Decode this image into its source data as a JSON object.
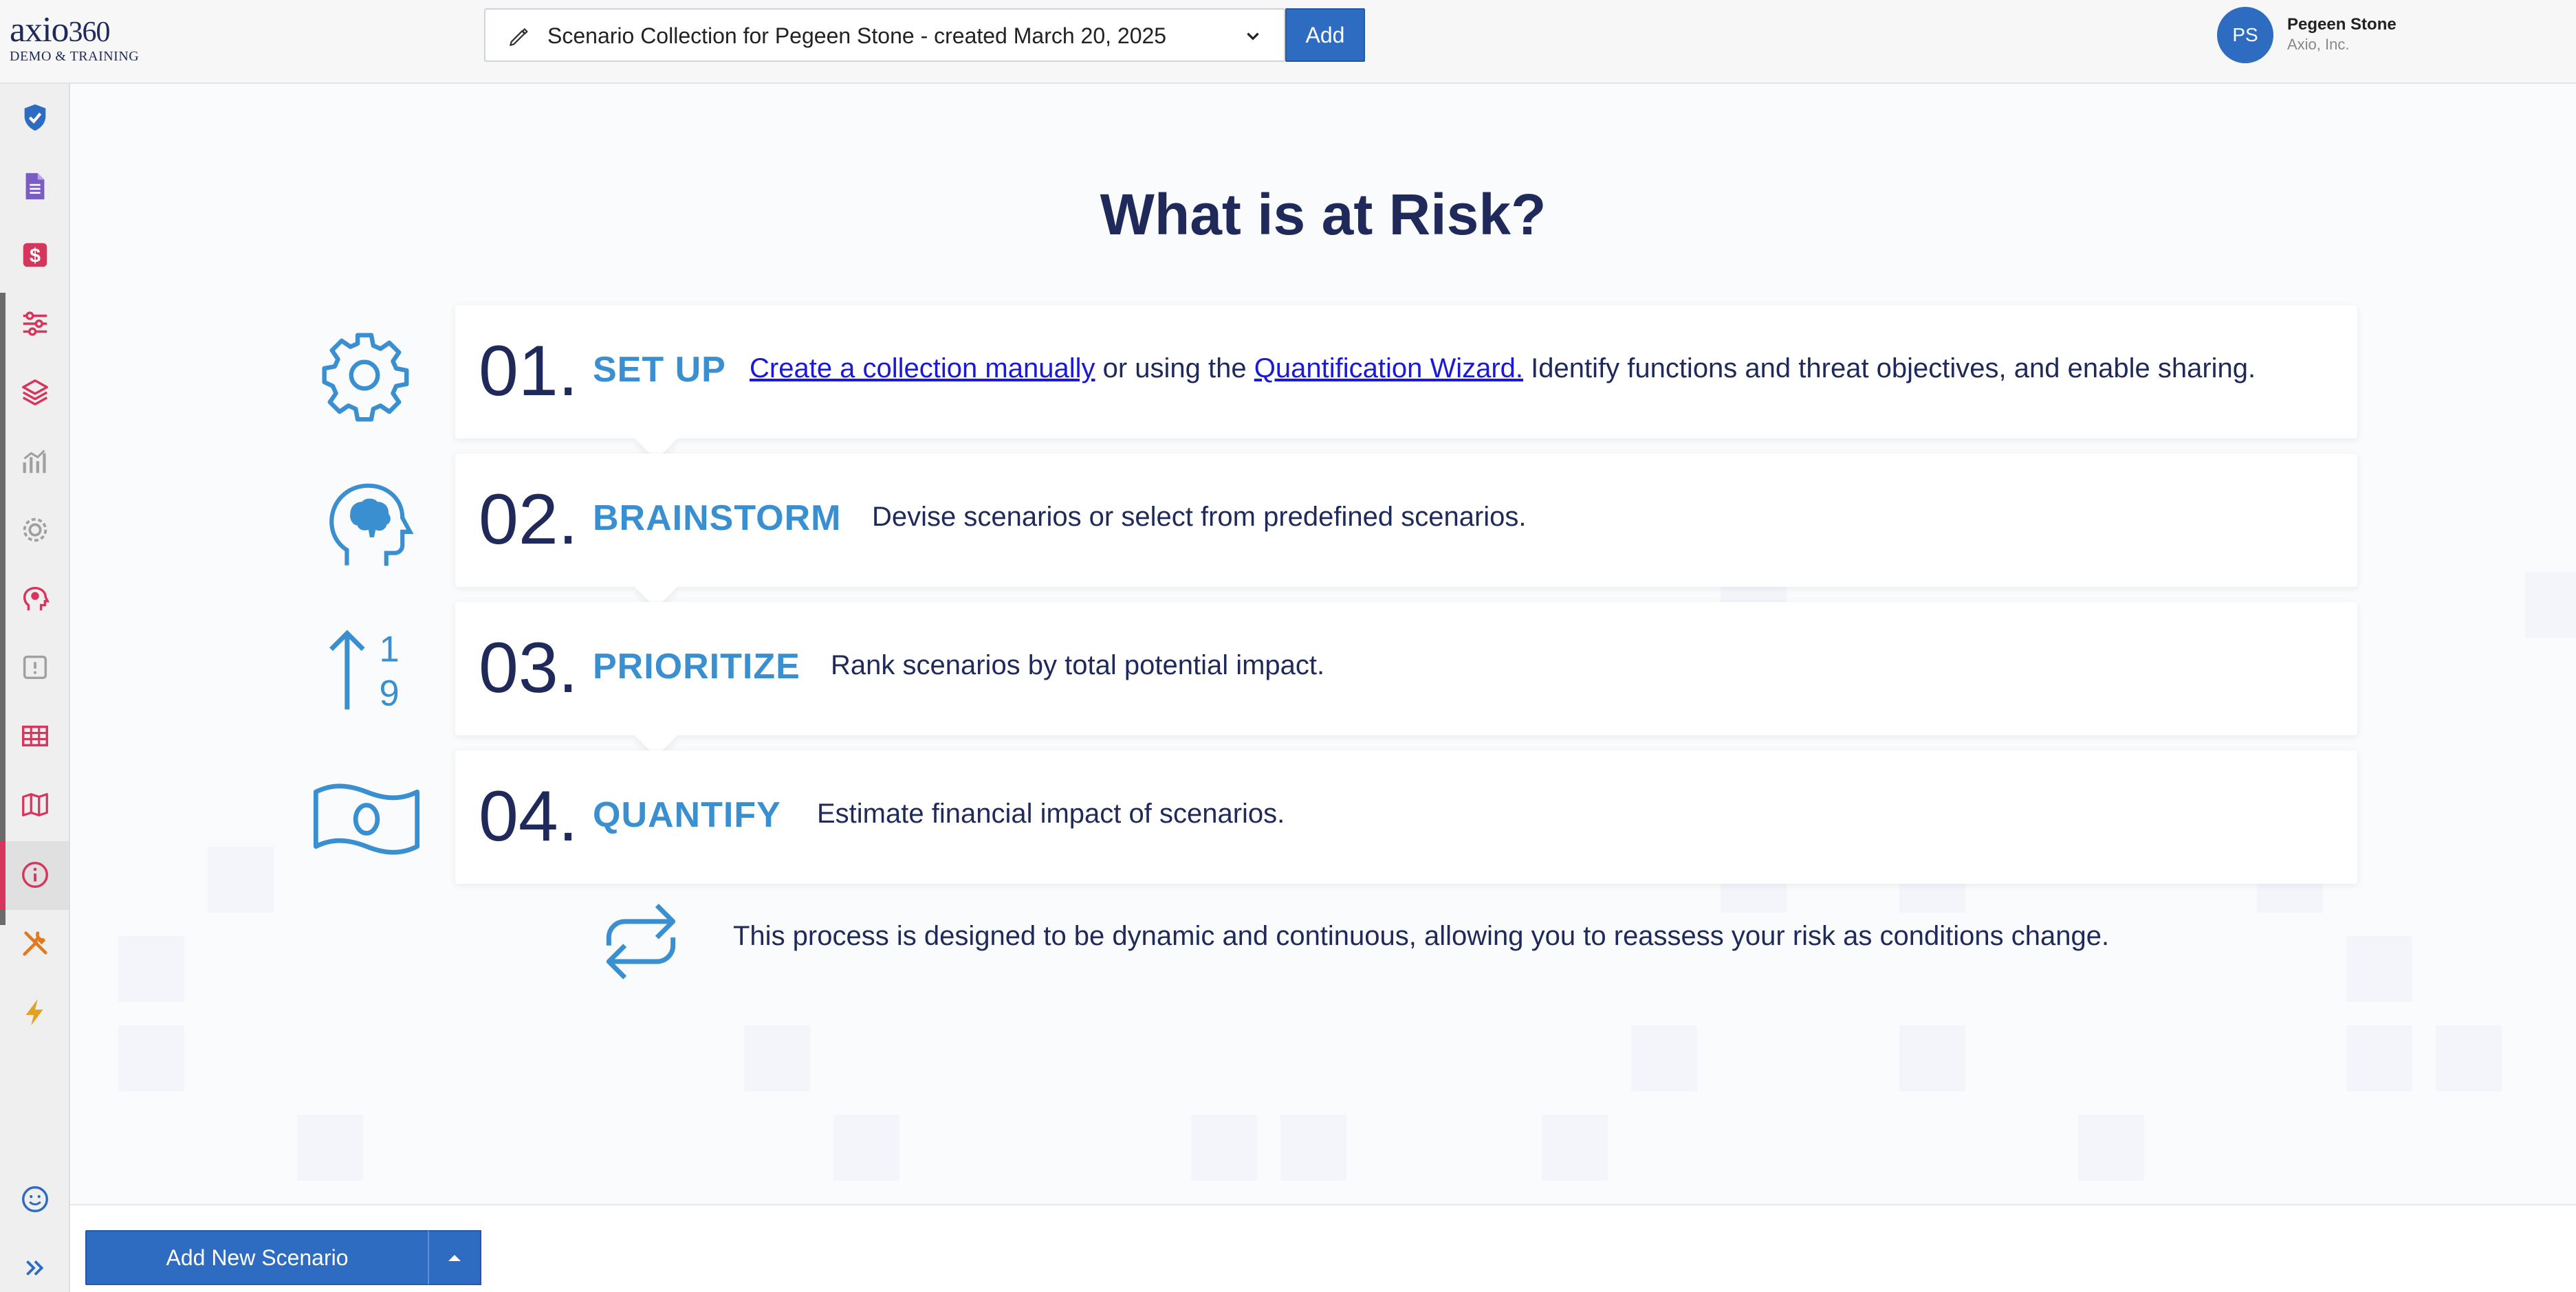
{
  "header": {
    "logo": {
      "name": "axio",
      "number": "360",
      "subtitle": "DEMO & TRAINING"
    },
    "collection": {
      "value": "Scenario Collection for Pegeen Stone - created March 20, 2025"
    },
    "add_label": "Add",
    "user": {
      "initials": "PS",
      "name": "Pegeen Stone",
      "org": "Axio, Inc."
    }
  },
  "sidebar": {
    "items": [
      {
        "icon": "shield-check-icon",
        "color": "#2e6cc2"
      },
      {
        "icon": "document-icon",
        "color": "#7b5cc4"
      },
      {
        "icon": "dollar-icon",
        "color": "#d6365c"
      },
      {
        "icon": "sliders-icon",
        "color": "#d6365c"
      },
      {
        "icon": "layers-icon",
        "color": "#d6365c"
      },
      {
        "icon": "analytics-icon",
        "color": "#a0a0a0"
      },
      {
        "icon": "gear-badge-icon",
        "color": "#a0a0a0"
      },
      {
        "icon": "brain-head-icon",
        "color": "#d6365c"
      },
      {
        "icon": "alert-box-icon",
        "color": "#a0a0a0"
      },
      {
        "icon": "table-icon",
        "color": "#d6365c"
      },
      {
        "icon": "map-icon",
        "color": "#d6365c"
      },
      {
        "icon": "info-icon",
        "color": "#d6365c"
      },
      {
        "icon": "tools-icon",
        "color": "#e07a1f"
      },
      {
        "icon": "bolt-icon",
        "color": "#e0a21f"
      },
      {
        "icon": "smiley-icon",
        "color": "#2e6cc2"
      },
      {
        "icon": "expand-icon",
        "color": "#2e6cc2"
      }
    ]
  },
  "main": {
    "title": "What is at Risk?",
    "steps": [
      {
        "number": "01.",
        "label": "SET UP",
        "link1": "Create a collection manually",
        "mid": " or using the ",
        "link2": "Quantification Wizard.",
        "rest": "  Identify functions and threat objectives, and enable sharing."
      },
      {
        "number": "02.",
        "label": "BRAINSTORM",
        "description": "Devise scenarios or select from predefined scenarios."
      },
      {
        "number": "03.",
        "label": "PRIORITIZE",
        "description": "Rank scenarios by total potential impact."
      },
      {
        "number": "04.",
        "label": "QUANTIFY",
        "description": "Estimate financial impact of scenarios."
      }
    ],
    "prioritize_icon": {
      "top": "1",
      "bottom": "9"
    },
    "process_note": "This process is designed to be dynamic and continuous, allowing you to reassess your risk as conditions change."
  },
  "footer": {
    "add_scenario_label": "Add New Scenario"
  },
  "colors": {
    "accent": "#2e6cc2",
    "step_blue": "#3a8fd0",
    "navy": "#1f2a5a",
    "link": "#1a1ad6"
  }
}
